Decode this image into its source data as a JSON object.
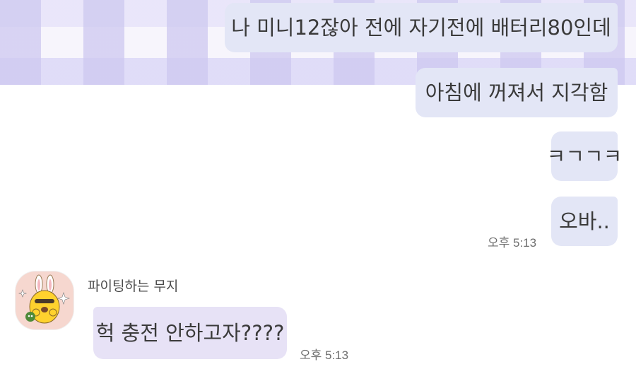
{
  "conversation": {
    "sent_messages": [
      {
        "text": "나 미니12잖아 전에 자기전에 배터리80인데"
      },
      {
        "text": "아침에 꺼져서 지각함"
      },
      {
        "text": "ㅋㄱㄱㅋ"
      },
      {
        "text": "오바.."
      }
    ],
    "sent_time": "오후 5:13",
    "received": {
      "sender_name": "파이팅하는 무지",
      "avatar_icon": "muzi-character-icon",
      "message": "헉 충전 안하고자????",
      "time": "오후 5:13"
    }
  },
  "colors": {
    "sent_bubble": "#e3e6f6",
    "received_bubble": "#e7e2f6",
    "avatar_bg": "#f6d7cf"
  }
}
